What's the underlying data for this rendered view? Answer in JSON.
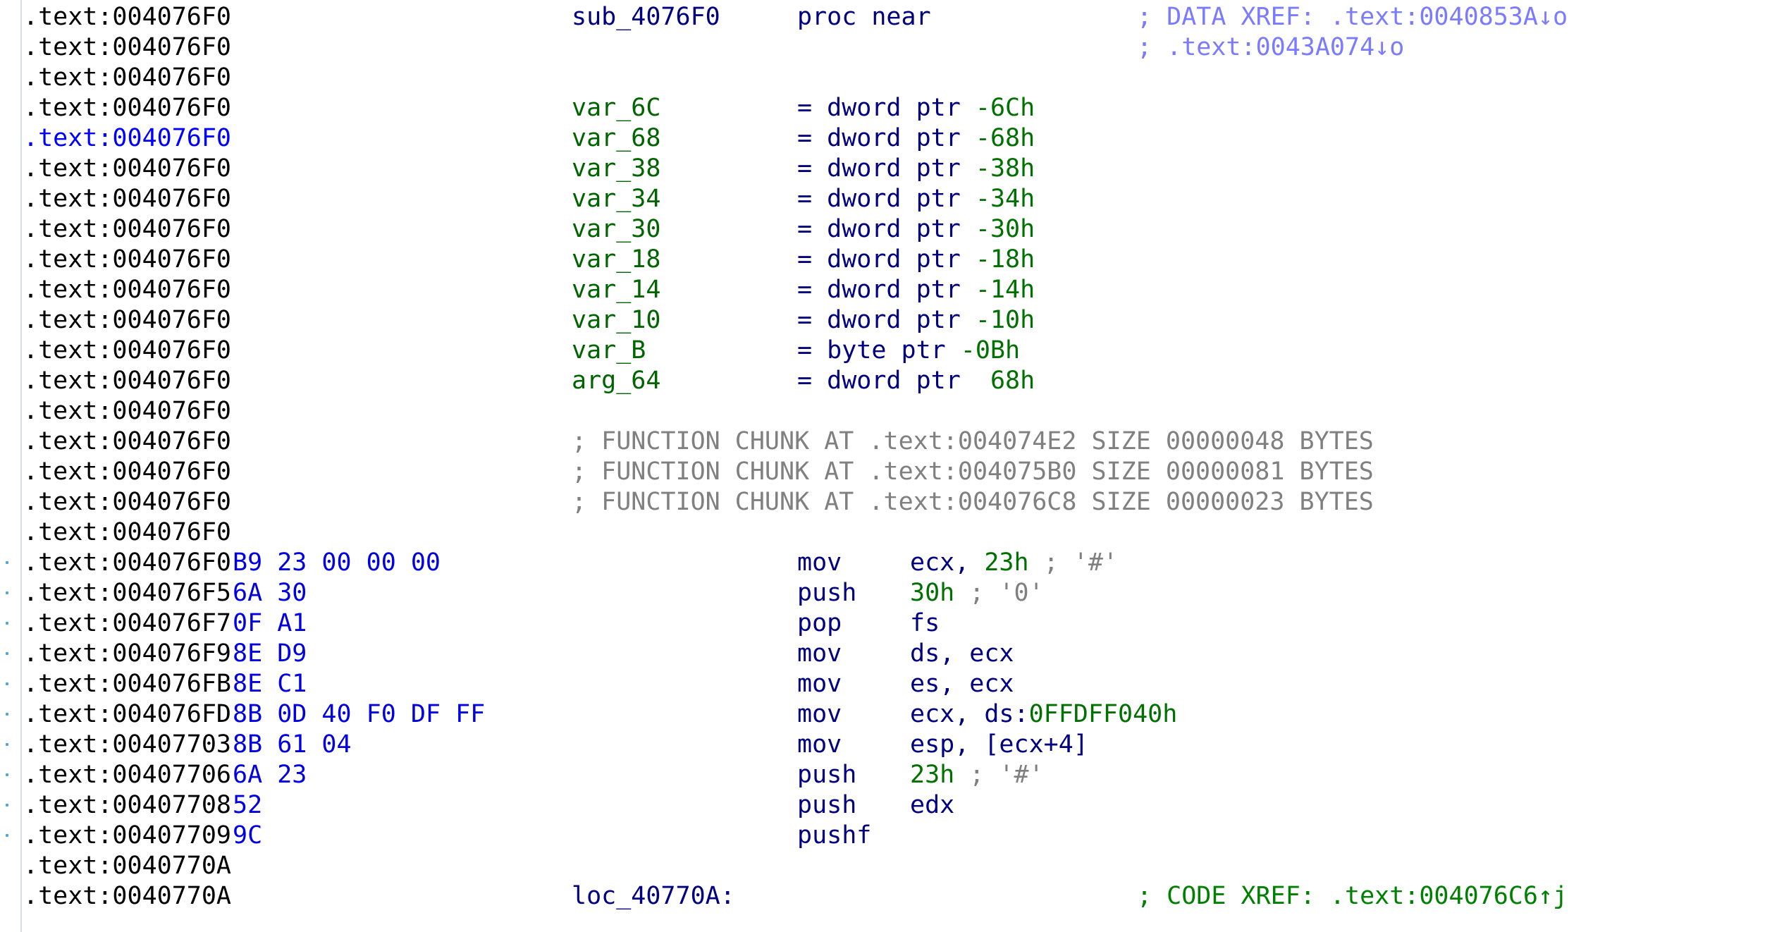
{
  "ida_view": {
    "gutter_marker_color": "#58a6d6",
    "lines": [
      {
        "addr": ".text:004076F0",
        "label": "sub_4076F0",
        "mnemonic": "proc near",
        "comment": "; DATA XREF: .text:0040853A↓o"
      },
      {
        "addr": ".text:004076F0",
        "comment": "; .text:0043A074↓o"
      },
      {
        "addr": ".text:004076F0"
      },
      {
        "addr": ".text:004076F0",
        "var": "var_6C",
        "def": "= dword ptr -6Ch"
      },
      {
        "addr": ".text:004076F0",
        "var": "var_68",
        "def": "= dword ptr -68h",
        "highlight": true
      },
      {
        "addr": ".text:004076F0",
        "var": "var_38",
        "def": "= dword ptr -38h"
      },
      {
        "addr": ".text:004076F0",
        "var": "var_34",
        "def": "= dword ptr -34h"
      },
      {
        "addr": ".text:004076F0",
        "var": "var_30",
        "def": "= dword ptr -30h"
      },
      {
        "addr": ".text:004076F0",
        "var": "var_18",
        "def": "= dword ptr -18h"
      },
      {
        "addr": ".text:004076F0",
        "var": "var_14",
        "def": "= dword ptr -14h"
      },
      {
        "addr": ".text:004076F0",
        "var": "var_10",
        "def": "= dword ptr -10h"
      },
      {
        "addr": ".text:004076F0",
        "var": "var_B",
        "def": "= byte ptr -0Bh"
      },
      {
        "addr": ".text:004076F0",
        "var": "arg_64",
        "def": "= dword ptr  68h"
      },
      {
        "addr": ".text:004076F0"
      },
      {
        "addr": ".text:004076F0",
        "chunk": "; FUNCTION CHUNK AT .text:004074E2 SIZE 00000048 BYTES"
      },
      {
        "addr": ".text:004076F0",
        "chunk": "; FUNCTION CHUNK AT .text:004075B0 SIZE 00000081 BYTES"
      },
      {
        "addr": ".text:004076F0",
        "chunk": "; FUNCTION CHUNK AT .text:004076C8 SIZE 00000023 BYTES"
      },
      {
        "addr": ".text:004076F0"
      },
      {
        "addr": ".text:004076F0",
        "bytes": "B9 23 00 00 00",
        "mnemonic": "mov",
        "operands": "ecx, 23h",
        "op_comment": " ; '#'",
        "marker": true
      },
      {
        "addr": ".text:004076F5",
        "bytes": "6A 30",
        "mnemonic": "push",
        "operands": "30h",
        "op_comment": " ; '0'",
        "marker": true
      },
      {
        "addr": ".text:004076F7",
        "bytes": "0F A1",
        "mnemonic": "pop",
        "operands": "fs",
        "marker": true
      },
      {
        "addr": ".text:004076F9",
        "bytes": "8E D9",
        "mnemonic": "mov",
        "operands": "ds, ecx",
        "marker": true
      },
      {
        "addr": ".text:004076FB",
        "bytes": "8E C1",
        "mnemonic": "mov",
        "operands": "es, ecx",
        "marker": true
      },
      {
        "addr": ".text:004076FD",
        "bytes": "8B 0D 40 F0 DF FF",
        "mnemonic": "mov",
        "operands": "ecx, ds:0FFDFF040h",
        "marker": true
      },
      {
        "addr": ".text:00407703",
        "bytes": "8B 61 04",
        "mnemonic": "mov",
        "operands": "esp, [ecx+4]",
        "marker": true
      },
      {
        "addr": ".text:00407706",
        "bytes": "6A 23",
        "mnemonic": "push",
        "operands": "23h",
        "op_comment": " ; '#'",
        "marker": true
      },
      {
        "addr": ".text:00407708",
        "bytes": "52",
        "mnemonic": "push",
        "operands": "edx",
        "marker": true
      },
      {
        "addr": ".text:00407709",
        "bytes": "9C",
        "mnemonic": "pushf",
        "marker": true
      },
      {
        "addr": ".text:0040770A"
      },
      {
        "addr": ".text:0040770A",
        "label": "loc_40770A:",
        "comment": "; CODE XREF: .text:004076C6↑j",
        "comment_kind": "code"
      }
    ]
  }
}
